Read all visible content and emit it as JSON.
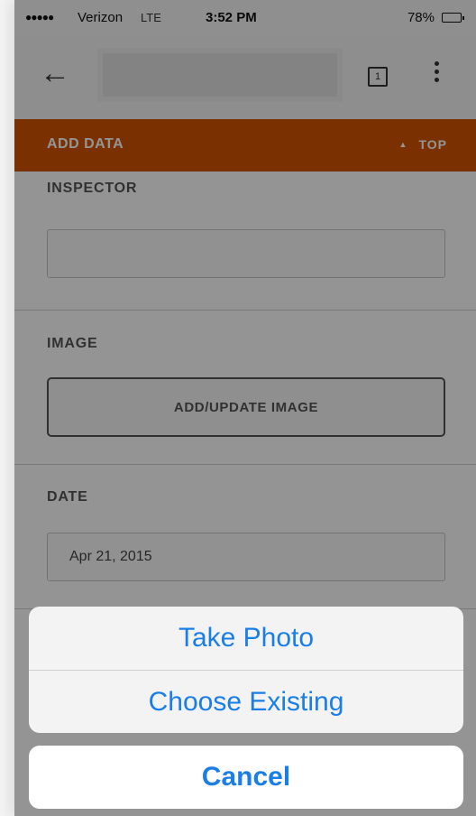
{
  "status_bar": {
    "signal": "●●●●●",
    "carrier": "Verizon",
    "network": "LTE",
    "time": "3:52 PM",
    "battery": "78%"
  },
  "toolbar": {
    "back_icon": "arrow-left-icon",
    "tab_count": "1",
    "menu_icon": "more-vert-icon"
  },
  "section": {
    "title": "ADD DATA",
    "top_link": "TOP",
    "accent_color": "#d25400"
  },
  "form": {
    "inspector": {
      "label": "INSPECTOR",
      "value": ""
    },
    "image": {
      "label": "IMAGE",
      "button_label": "ADD/UPDATE IMAGE"
    },
    "date": {
      "label": "DATE",
      "value": "Apr 21, 2015"
    }
  },
  "action_sheet": {
    "take_photo": "Take Photo",
    "choose_existing": "Choose Existing",
    "cancel": "Cancel",
    "button_color": "#1a7ee6"
  }
}
